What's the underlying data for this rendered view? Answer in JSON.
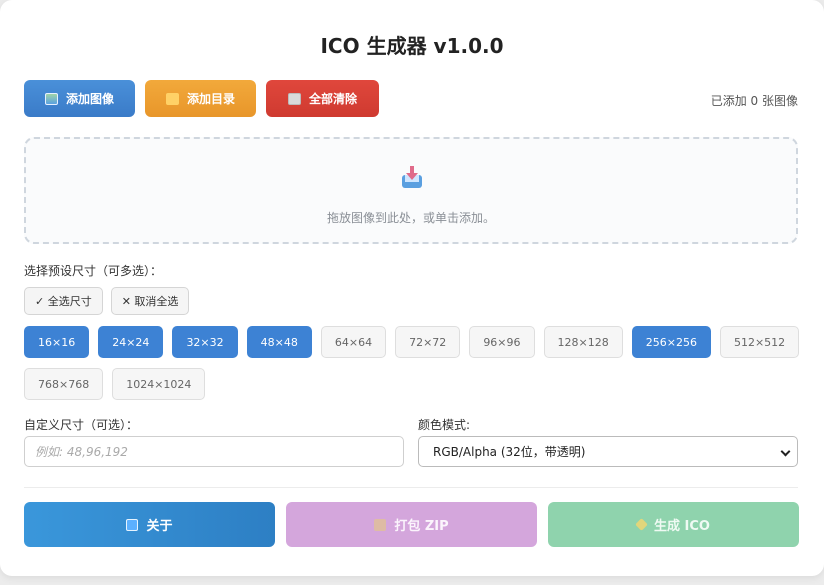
{
  "app": {
    "title": "ICO 生成器 v1.0.0"
  },
  "toolbar": {
    "add_image": "添加图像",
    "add_dir": "添加目录",
    "clear_all": "全部清除",
    "count_text": "已添加 0 张图像"
  },
  "dropzone": {
    "text": "拖放图像到此处，或单击添加。"
  },
  "presets": {
    "label": "选择预设尺寸（可多选）：",
    "select_all": "✓ 全选尺寸",
    "deselect_all": "✕ 取消全选",
    "sizes": [
      {
        "label": "16×16",
        "selected": true
      },
      {
        "label": "24×24",
        "selected": true
      },
      {
        "label": "32×32",
        "selected": true
      },
      {
        "label": "48×48",
        "selected": true
      },
      {
        "label": "64×64",
        "selected": false
      },
      {
        "label": "72×72",
        "selected": false
      },
      {
        "label": "96×96",
        "selected": false
      },
      {
        "label": "128×128",
        "selected": false
      },
      {
        "label": "256×256",
        "selected": true
      },
      {
        "label": "512×512",
        "selected": false
      },
      {
        "label": "768×768",
        "selected": false
      },
      {
        "label": "1024×1024",
        "selected": false
      }
    ]
  },
  "custom": {
    "label": "自定义尺寸（可选）：",
    "placeholder": "例如: 48,96,192",
    "value": ""
  },
  "color_mode": {
    "label": "颜色模式:",
    "selected": "RGB/Alpha (32位，带透明)"
  },
  "actions": {
    "about": "关于",
    "zip": "打包 ZIP",
    "generate": "生成 ICO"
  },
  "colors": {
    "accent": "#3d82d4",
    "orange": "#e8962a",
    "red": "#cf3a30",
    "purple": "#d4a6dc",
    "green": "#8fd3ad"
  },
  "icons": {
    "add_image": "image-icon",
    "add_dir": "folder-icon",
    "clear_all": "trash-icon",
    "drop": "inbox-download-icon",
    "about": "info-icon",
    "zip": "package-icon",
    "generate": "sparkles-icon"
  }
}
